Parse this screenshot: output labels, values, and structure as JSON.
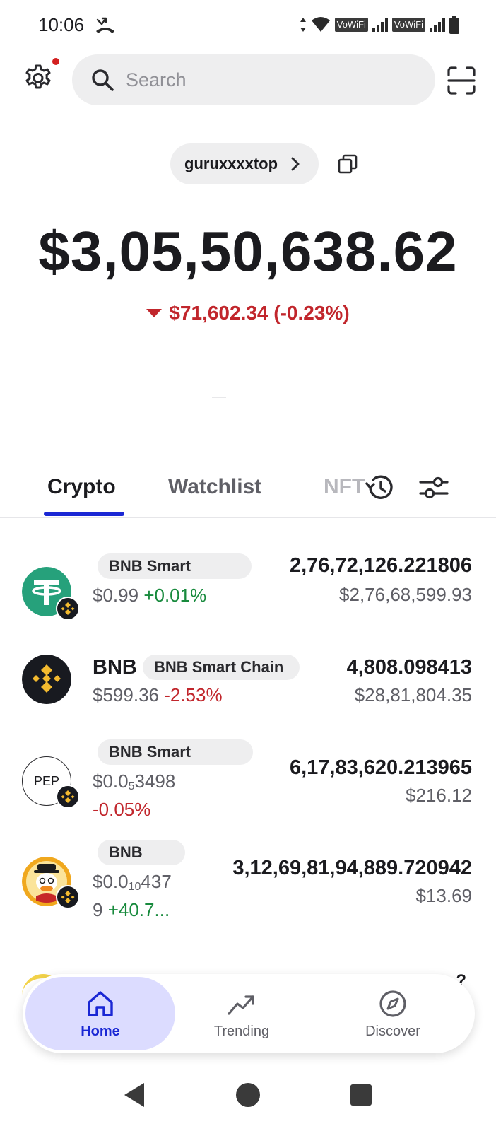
{
  "status_bar": {
    "time": "10:06",
    "vowifi_1": "VoWiFi",
    "vowifi_2": "VoWiFi"
  },
  "header": {
    "search_placeholder": "Search",
    "notification_dot_color": "#d32020"
  },
  "wallet": {
    "name": "guruxxxxtop",
    "balance": "$3,05,50,638.62",
    "change": "$71,602.34 (-0.23%)",
    "change_direction": "down"
  },
  "tabs": [
    {
      "label": "Crypto",
      "active": true
    },
    {
      "label": "Watchlist",
      "active": false
    },
    {
      "label": "NFT",
      "active": false
    }
  ],
  "assets": [
    {
      "name": "",
      "chain": "BNB Smart",
      "price": "$0.99",
      "change": "+0.01%",
      "direction": "up",
      "amount": "2,76,72,126.221806",
      "usd": "$2,76,68,599.93",
      "icon": "tether-icon"
    },
    {
      "name": "BNB",
      "chain": "BNB Smart Chain",
      "price": "$599.36",
      "change": "-2.53%",
      "direction": "down",
      "amount": "4,808.098413",
      "usd": "$28,81,804.35",
      "icon": "bnb-icon"
    },
    {
      "name": "",
      "chain": "BNB Smart",
      "price_prefix": "$0.0",
      "price_sub": "5",
      "price_rest": "3498",
      "change": "-0.05%",
      "direction": "down",
      "amount": "6,17,83,620.213965",
      "usd": "$216.12",
      "icon": "pep-icon",
      "icon_text": "PEP"
    },
    {
      "name": "",
      "chain": "BNB",
      "price_prefix": "$0.0",
      "price_sub": "10",
      "price_rest": "437",
      "price_wrap": "9",
      "change": "+40.7...",
      "direction": "up",
      "amount": "3,12,69,81,94,889.720942",
      "usd": "$13.69",
      "icon": "duck-coin-icon"
    }
  ],
  "partial_row_text": "?",
  "bottom_nav": [
    {
      "label": "Home",
      "icon": "home-icon",
      "active": true
    },
    {
      "label": "Trending",
      "icon": "trending-icon",
      "active": false
    },
    {
      "label": "Discover",
      "icon": "compass-icon",
      "active": false
    }
  ],
  "colors": {
    "accent": "#1a27d4",
    "up": "#188a3d",
    "down": "#c1262c",
    "nav_active_bg": "#dcdcff"
  }
}
